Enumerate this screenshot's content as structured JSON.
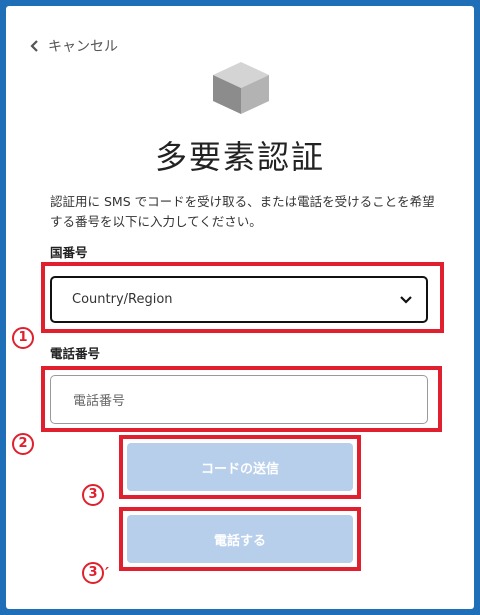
{
  "header": {
    "back_label": "キャンセル"
  },
  "page": {
    "title": "多要素認証",
    "description": "認証用に SMS でコードを受け取る、または電話を受けることを希望する番号を以下に入力してください。"
  },
  "form": {
    "country_label": "国番号",
    "country_select_value": "Country/Region",
    "phone_label": "電話番号",
    "phone_placeholder": "電話番号",
    "send_code_button": "コードの送信",
    "call_button": "電話する"
  },
  "annotations": {
    "marker_1": "1",
    "marker_2": "2",
    "marker_3": "3",
    "marker_3b": "3",
    "marker_3b_prime": "′",
    "color": "#e0202e"
  },
  "colors": {
    "background": "#1f6fb8",
    "button_disabled": "#b8cfec",
    "highlight": "#e0202e"
  },
  "icons": {
    "back": "chevron-left-icon",
    "logo": "cube-logo-icon",
    "select": "chevron-down-icon"
  }
}
